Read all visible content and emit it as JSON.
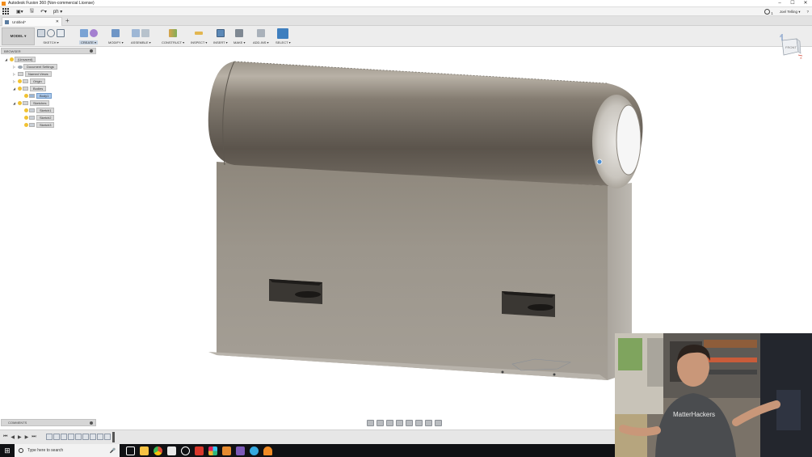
{
  "window": {
    "title": "Autodesk Fusion 360 (Non-commercial License)",
    "controls": [
      "–",
      "☐",
      "✕"
    ]
  },
  "qat": {
    "grid_icon": "app-grid-icon",
    "file_icon": "file-icon",
    "save_icon": "save-icon",
    "undo_icon": "undo-icon",
    "redo_label": "ph ▾",
    "job_status": "1",
    "user_name": "Joel Telling ▾",
    "help": "?"
  },
  "tabs": {
    "document": "Untitled*",
    "close": "✕",
    "add": "+"
  },
  "ribbon": {
    "workspace": "MODEL ▾",
    "groups": [
      {
        "label": "SKETCH ▾"
      },
      {
        "label": "CREATE ▾"
      },
      {
        "label": "MODIFY ▾"
      },
      {
        "label": "ASSEMBLE ▾"
      },
      {
        "label": "CONSTRUCT ▾"
      },
      {
        "label": "INSPECT ▾"
      },
      {
        "label": "INSERT ▾"
      },
      {
        "label": "MAKE ▾"
      },
      {
        "label": "ADD-INS ▾"
      },
      {
        "label": "SELECT ▾"
      }
    ]
  },
  "browser": {
    "title": "BROWSER",
    "root": "(Unsaved)",
    "items": [
      {
        "label": "Document Settings"
      },
      {
        "label": "Named Views"
      },
      {
        "label": "Origin"
      },
      {
        "label": "Bodies"
      },
      {
        "label": "Body1"
      },
      {
        "label": "Sketches"
      },
      {
        "label": "Sketch1"
      },
      {
        "label": "Sketch2"
      },
      {
        "label": "Sketch3"
      }
    ]
  },
  "viewcube": {
    "face": "FRONT",
    "axis_z": "Z",
    "axis_x": "X"
  },
  "comments": {
    "title": "COMMENTS"
  },
  "timeline": {
    "controls": [
      "⏮",
      "◀",
      "▶",
      "▶",
      "⏭"
    ],
    "step_count": 10,
    "settings": "⚙"
  },
  "taskbar": {
    "start": "⊞",
    "search_placeholder": "Type here to search",
    "mic": "🎤",
    "apps": [
      {
        "name": "task-view-icon",
        "color": "#ffffff"
      },
      {
        "name": "file-explorer-icon",
        "color": "#f6c344"
      },
      {
        "name": "chrome-icon",
        "color": "#dd4b39"
      },
      {
        "name": "fusion-icon",
        "color": "#ffffff"
      },
      {
        "name": "obs-icon",
        "color": "#ffffff"
      },
      {
        "name": "app-red-icon",
        "color": "#d9372b"
      },
      {
        "name": "slack-icon",
        "color": "#4a154b"
      },
      {
        "name": "app-orange-icon",
        "color": "#e58a2f"
      },
      {
        "name": "premiere-icon",
        "color": "#7c5ab8"
      },
      {
        "name": "app-cyan-icon",
        "color": "#36a9e0"
      },
      {
        "name": "app-flame-icon",
        "color": "#f08a24"
      }
    ]
  },
  "webcam": {
    "shirt_text": "MatterHackers"
  }
}
